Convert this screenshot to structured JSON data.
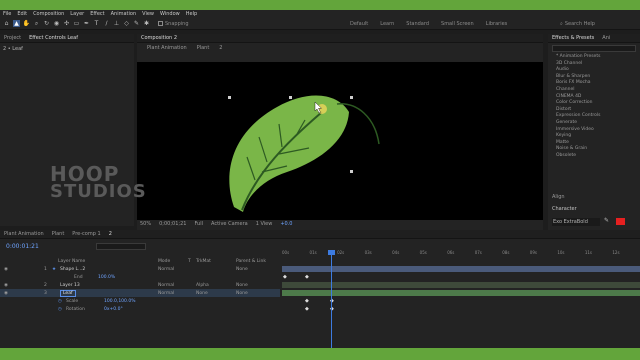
{
  "menu": [
    "File",
    "Edit",
    "Composition",
    "Layer",
    "Effect",
    "Animation",
    "View",
    "Window",
    "Help"
  ],
  "toolbar": {
    "snapping_label": "Snapping",
    "workspaces": [
      "Default",
      "Learn",
      "Standard",
      "Small Screen",
      "Libraries"
    ],
    "search_help": "Search Help"
  },
  "left_panel": {
    "tabs": [
      "Project",
      "Effect Controls Leaf"
    ],
    "layer_path": "2 • Leaf"
  },
  "comp_panel": {
    "tab": "Composition 2",
    "breadcrumbs": [
      "Plant Animation",
      "Plant",
      "2"
    ]
  },
  "viewer_bar": {
    "zoom": "50%",
    "timecode": "0;00;01;21",
    "resolution": "Full",
    "camera": "Active Camera",
    "views": "1 View",
    "exposure": "+0.0"
  },
  "watermark": {
    "line1": "HOOP",
    "line2": "STUDIOS"
  },
  "effects_panel": {
    "tabs": [
      "Effects & Presets",
      "Ani"
    ],
    "items": [
      "* Animation Presets",
      "3D Channel",
      "Audio",
      "Blur & Sharpen",
      "Boris FX Mocha",
      "Channel",
      "CINEMA 4D",
      "Color Correction",
      "Distort",
      "Expression Controls",
      "Generate",
      "Immersive Video",
      "Keying",
      "Matte",
      "Noise & Grain",
      "Obsolete"
    ],
    "align_label": "Align",
    "character_label": "Character",
    "font_name": "Exo ExtraBold",
    "swatch_color": "#e62020"
  },
  "timeline": {
    "tabs": [
      "Plant Animation",
      "Plant",
      "Pre-comp 1",
      "2"
    ],
    "timecode": "0:00:01:21",
    "headers": {
      "layer_name": "Layer Name",
      "mode": "Mode",
      "t": "T",
      "trkmat": "TrkMat",
      "parent": "Parent & Link"
    },
    "ruler": [
      "00s",
      "01s",
      "02s",
      "03s",
      "04s",
      "05s",
      "06s",
      "07s",
      "08s",
      "09s",
      "10s",
      "11s",
      "12s"
    ],
    "layers": [
      {
        "num": "1",
        "name": "Shape L...2",
        "mode": "Normal",
        "trkmat": "",
        "parent": "None"
      },
      {
        "num": "",
        "name": "End",
        "mode": "",
        "trkmat": "",
        "parent": "",
        "value": "100.0%"
      },
      {
        "num": "2",
        "name": "Layer 13",
        "mode": "Normal",
        "trkmat": "Alpha",
        "parent": "None"
      },
      {
        "num": "3",
        "name": "Leaf",
        "mode": "Normal",
        "trkmat": "None",
        "parent": "None"
      },
      {
        "num": "",
        "name": "Scale",
        "mode": "",
        "trkmat": "",
        "parent": "",
        "value": "100.0,100.0%"
      },
      {
        "num": "",
        "name": "Rotation",
        "mode": "",
        "trkmat": "",
        "parent": "",
        "value": "0x+0.0°"
      }
    ]
  },
  "colors": {
    "background": "#63a53b",
    "leaf": "#7ab648",
    "vein": "#2d5a22",
    "accent_blue": "#5a8ee6",
    "playhead": "#3d7be0"
  }
}
